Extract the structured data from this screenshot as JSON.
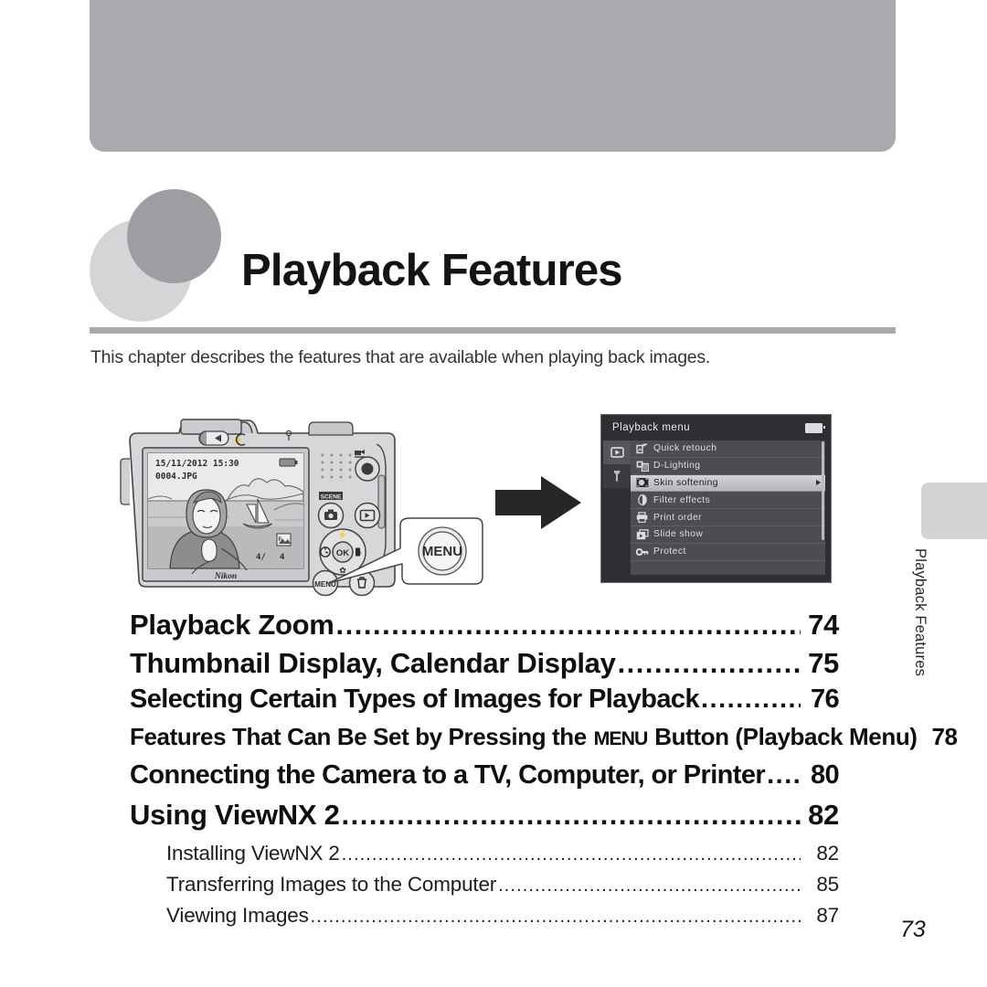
{
  "page": {
    "folio": "73",
    "chapter_title": "Playback Features",
    "intro": "This chapter describes the features that are available when playing back images.",
    "side_tab_label": "Playback Features"
  },
  "camera": {
    "brand": "Nikon",
    "lcd": {
      "date": "15/11/2012",
      "time": "15:30",
      "filename": "0004.JPG",
      "frame_current": "4/",
      "frame_total": "4"
    },
    "buttons": {
      "scene_label": "SCENE",
      "ok_label": "OK",
      "menu_label": "MENU"
    },
    "callout_label": "MENU"
  },
  "playback_menu": {
    "title": "Playback menu",
    "tabs": [
      {
        "name": "playback-tab",
        "glyph": "play",
        "active": true
      },
      {
        "name": "setup-tab",
        "glyph": "wrench",
        "active": false
      }
    ],
    "items": [
      {
        "label": "Quick retouch",
        "icon": "quick-retouch-icon",
        "selected": false,
        "has_submenu": false
      },
      {
        "label": "D-Lighting",
        "icon": "d-lighting-icon",
        "selected": false,
        "has_submenu": false
      },
      {
        "label": "Skin softening",
        "icon": "skin-softening-icon",
        "selected": true,
        "has_submenu": true
      },
      {
        "label": "Filter effects",
        "icon": "filter-effects-icon",
        "selected": false,
        "has_submenu": false
      },
      {
        "label": "Print order",
        "icon": "print-order-icon",
        "selected": false,
        "has_submenu": false
      },
      {
        "label": "Slide show",
        "icon": "slide-show-icon",
        "selected": false,
        "has_submenu": false
      },
      {
        "label": "Protect",
        "icon": "protect-icon",
        "selected": false,
        "has_submenu": false
      }
    ]
  },
  "toc": {
    "main": [
      {
        "label": "Playback Zoom",
        "page": "74",
        "size": "normal"
      },
      {
        "label": "Thumbnail Display, Calendar Display",
        "page": "75",
        "size": "normal"
      },
      {
        "label": "Selecting Certain Types of Images for Playback",
        "page": "76",
        "size": "normal"
      },
      {
        "label": "Features That Can Be Set by Pressing the MENU Button (Playback Menu)",
        "page": "78",
        "size": "compact",
        "menu_glyph": true
      },
      {
        "label": "Connecting the Camera to a TV, Computer, or Printer",
        "page": "80",
        "size": "compact2"
      },
      {
        "label": "Using ViewNX 2",
        "page": "82",
        "size": "normal"
      }
    ],
    "sub": [
      {
        "label": "Installing ViewNX 2",
        "page": "82"
      },
      {
        "label": "Transferring Images to the Computer",
        "page": "85"
      },
      {
        "label": "Viewing Images",
        "page": "87"
      }
    ],
    "leader_char": "."
  },
  "colors": {
    "band_gray": "#a9aaad",
    "circle_light": "#d4d5d7",
    "circle_dark": "#9d9ea2",
    "menu_bg": "#2e2f33",
    "menu_list_bg": "#4c4d52",
    "menu_selected": "#c8c8cb"
  }
}
